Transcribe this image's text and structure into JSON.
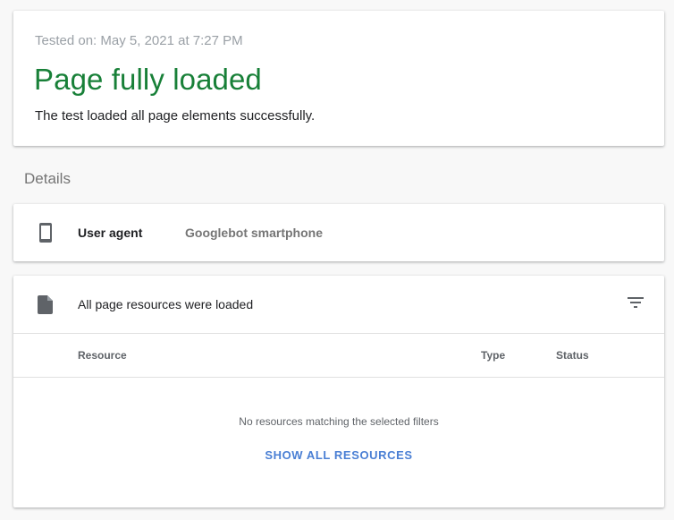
{
  "status": {
    "tested_on": "Tested on: May 5, 2021 at 7:27 PM",
    "title": "Page fully loaded",
    "description": "The test loaded all page elements successfully.",
    "title_color": "#188038"
  },
  "details": {
    "heading": "Details"
  },
  "user_agent": {
    "icon": "smartphone-icon",
    "label": "User agent",
    "value": "Googlebot smartphone"
  },
  "resources": {
    "icon": "document-icon",
    "title": "All page resources were loaded",
    "filter_icon": "filter-icon",
    "columns": [
      "Resource",
      "Type",
      "Status"
    ],
    "empty_message": "No resources matching the selected filters",
    "show_all_label": "SHOW ALL RESOURCES",
    "link_color": "#4a7fd4"
  }
}
